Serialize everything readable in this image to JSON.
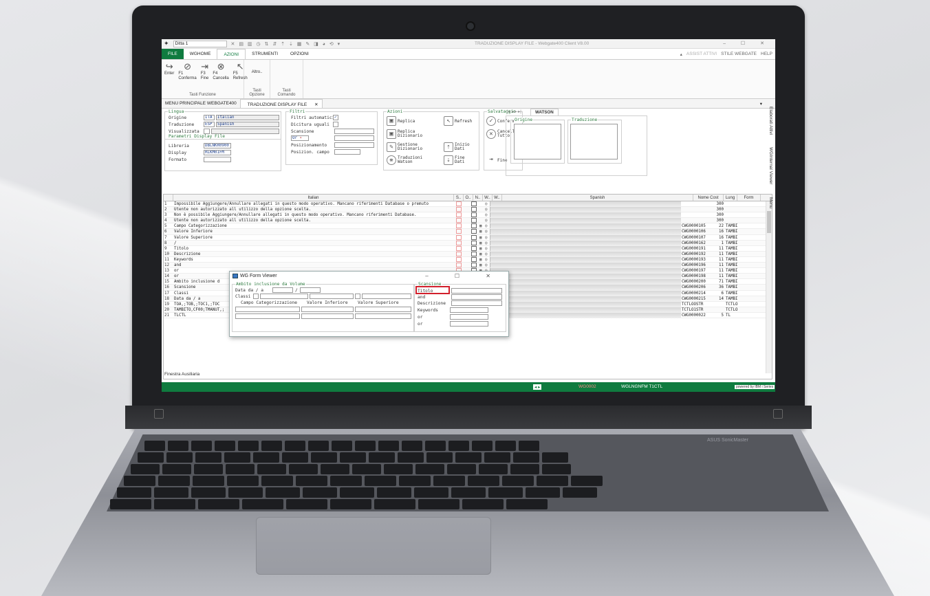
{
  "window": {
    "company": "Ditta 1",
    "title": "TRADUZIONE DISPLAY FILE  -  Webgate400 Client V8.00",
    "controls": "– ☐ ✕"
  },
  "menu": {
    "file": "FILE",
    "items": [
      "WGHOME",
      "AZIONI",
      "STRUMENTI",
      "OPZIONI"
    ],
    "right": [
      "ASSIST ATTIVI",
      "STILE WEBGATE",
      "HELP"
    ]
  },
  "ribbon": {
    "buttons": [
      {
        "icon": "enter-arrow-icon",
        "label": "Enter"
      },
      {
        "icon": "check-icon",
        "label": "F1\nConferma"
      },
      {
        "icon": "exit-icon",
        "label": "F3\nFine"
      },
      {
        "icon": "cancel-icon",
        "label": "F4\nCancella"
      },
      {
        "icon": "cursor-icon",
        "label": "F5\nRefresh"
      }
    ],
    "altro": "Altro..",
    "groups": [
      "Tasti Funzione",
      "Tasti Opzione",
      "Tasti Comando"
    ]
  },
  "tabs": [
    "MENU PRINCIPALE WEBGATE400",
    "TRADUZIONE DISPLAY FILE"
  ],
  "lingua": {
    "legend": "Lingua",
    "origine_lbl": "Origine",
    "origine_code": "ITA",
    "origine_name": "Italian",
    "trad_lbl": "Traduzione",
    "trad_code": "ESP",
    "trad_name": "Spanish",
    "vis_lbl": "Visualizzata"
  },
  "param": {
    "legend": "Parametri Display File",
    "libreria_lbl": "Libreria",
    "libreria": "DBLNKR0900",
    "display_lbl": "Display",
    "display": "RLKM01FM",
    "formato_lbl": "Formato"
  },
  "filtri": {
    "legend": "Filtri",
    "auto": "Filtri automatici",
    "dic": "Dicitura uguali",
    "scans": "Scansione",
    "or_val": "Or",
    "posiz": "Posizionamento",
    "posiz_campo": "Posizion. campo"
  },
  "azioni": {
    "legend": "Azioni",
    "replica": "Replica",
    "refresh": "Refresh",
    "replica_diz": "Replica\nDizionario",
    "gestione": "Gestione\nDizionario",
    "inizio": "Inizio\nDati",
    "traduzioni": "Traduzioni\nWatson",
    "fine_dati": "Fine\nDati"
  },
  "salvataggio": {
    "legend": "Salvataggio",
    "conferma": "Conferma",
    "cancella": "Cancella\nTutto",
    "fine": "Fine"
  },
  "watson": {
    "nav": "|◂ ◂ ▸ ▸|",
    "tab": "WATSON",
    "origine": "Origine",
    "traduzione": "Traduzione"
  },
  "grid": {
    "headers": {
      "italian": "Italian",
      "s": "S..",
      "o": "O..",
      "n": "N..",
      "w1": "W..",
      "w2": "W..",
      "spanish": "Spanish",
      "nome": "Nome Cost",
      "lung": "Lung",
      "form": "Form"
    },
    "rows": [
      {
        "n": "1",
        "it": "Impossibile Aggiungere/Annullare allegati in questo modo operativo. Mancano riferimenti Database o premuto",
        "nome": "",
        "lung": "300",
        "fmt": ""
      },
      {
        "n": "2",
        "it": "Utente non autorizzato all utilizzo della opzione scelta.",
        "nome": "",
        "lung": "300",
        "fmt": ""
      },
      {
        "n": "3",
        "it": "Non è possibile Aggiungere/Annullare allegati in questo modo operativo. Mancano riferimenti Database.",
        "nome": "",
        "lung": "300",
        "fmt": ""
      },
      {
        "n": "4",
        "it": "Utente non autorizzato all utilizzo della opzione scelta.",
        "nome": "",
        "lung": "300",
        "fmt": ""
      },
      {
        "n": "5",
        "it": "Campo Categorizzazione",
        "nome": "CWG0000105",
        "lung": "22",
        "fmt": "TAMBI"
      },
      {
        "n": "6",
        "it": "Valore Inferiore",
        "nome": "CWG0000106",
        "lung": "16",
        "fmt": "TAMBI"
      },
      {
        "n": "7",
        "it": "Valore Superiore",
        "nome": "CWG0000107",
        "lung": "16",
        "fmt": "TAMBI"
      },
      {
        "n": "8",
        "it": "/",
        "nome": "CWG0000162",
        "lung": "1",
        "fmt": "TAMBI"
      },
      {
        "n": "9",
        "it": "Titolo",
        "nome": "CWG0000191",
        "lung": "11",
        "fmt": "TAMBI"
      },
      {
        "n": "10",
        "it": "Descrizione",
        "nome": "CWG0000192",
        "lung": "11",
        "fmt": "TAMBI"
      },
      {
        "n": "11",
        "it": "Keywords",
        "nome": "CWG0000193",
        "lung": "11",
        "fmt": "TAMBI"
      },
      {
        "n": "12",
        "it": "and",
        "nome": "CWG0000196",
        "lung": "11",
        "fmt": "TAMBI"
      },
      {
        "n": "13",
        "it": "or",
        "nome": "CWG0000197",
        "lung": "11",
        "fmt": "TAMBI"
      },
      {
        "n": "14",
        "it": "or",
        "nome": "CWG0000198",
        "lung": "11",
        "fmt": "TAMBI"
      },
      {
        "n": "15",
        "it": "Ambito inclusione d",
        "nome": "CWG0000200",
        "lung": "71",
        "fmt": "TAMBI"
      },
      {
        "n": "16",
        "it": "Scansione",
        "nome": "CWG0000206",
        "lung": "36",
        "fmt": "TAMBI"
      },
      {
        "n": "17",
        "it": "Classi",
        "nome": "CWG0000214",
        "lung": "6",
        "fmt": "TAMBI"
      },
      {
        "n": "18",
        "it": "Data da / a",
        "nome": "CWG0000215",
        "lung": "14",
        "fmt": "TAMBI"
      },
      {
        "n": "19",
        "it": "TOA,;TOB,;TOC1,;TOC",
        "nome": "TCTLOOSTR",
        "lung": "",
        "fmt": "TCTLO"
      },
      {
        "n": "20",
        "it": "TAMBITO,CF00;TMANUT,;",
        "nome": "TCTLO1STR",
        "lung": "",
        "fmt": "TCTLO"
      },
      {
        "n": "21",
        "it": "TLCTL",
        "nome": "CWG0000022",
        "lung": "5",
        "fmt": "TL"
      }
    ]
  },
  "popup": {
    "title": "WG Form Viewer",
    "controls": "– ☐ ✕",
    "ambito": "Ambito inclusione da Volume",
    "data": "Data da / a",
    "classi": "Classi",
    "col1": "Campo Categorizzazione",
    "col2": "Valore Inferiore",
    "col3": "Valore Superiore",
    "scans": "Scansione",
    "titolo": "Titolo",
    "and": "and",
    "descr": "Descrizione",
    "keyw": "Keywords",
    "or1": "or",
    "or2": "or"
  },
  "footer": {
    "finestra": "Finestra Ausiliaria",
    "code": "WG0002",
    "program": "WGLNGNFM T1CTL",
    "powered": "powered by IBM i Series"
  },
  "side": [
    "Elaborati Attivi",
    "WGInternal Viewer",
    "Menu"
  ],
  "keyboard": {
    "brand": "ASUS SonicMaster"
  },
  "colors": {
    "accent": "#0f7b3f",
    "highlight": "#d21f2b",
    "legend": "#2c7a3e"
  }
}
